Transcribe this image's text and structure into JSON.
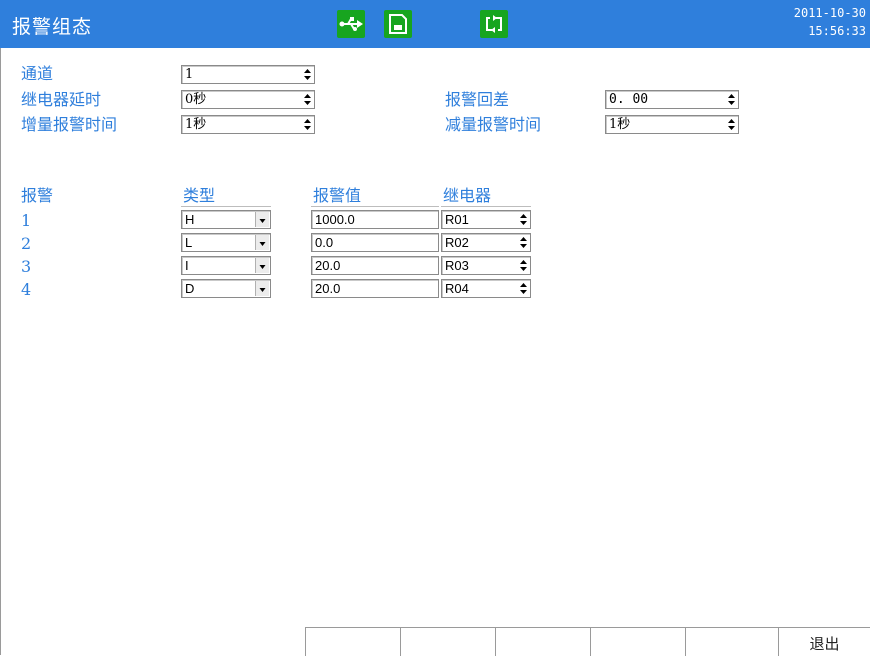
{
  "header": {
    "title": "报警组态",
    "date": "2011-10-30",
    "time": "15:56:33",
    "icons": [
      "usb-icon",
      "save-icon",
      "sync-icon"
    ],
    "accent_color": "#2f7fdc",
    "icon_color": "#17a51f"
  },
  "settings": {
    "channel_label": "通道",
    "channel_value": "1",
    "relay_delay_label": "继电器延时",
    "relay_delay_value": "0秒",
    "hysteresis_label": "报警回差",
    "hysteresis_value": "0. 00",
    "increase_time_label": "增量报警时间",
    "increase_time_value": "1秒",
    "decrease_time_label": "减量报警时间",
    "decrease_time_value": "1秒"
  },
  "alarm_table": {
    "headers": {
      "alarm": "报警",
      "type": "类型",
      "value": "报警值",
      "relay": "继电器"
    },
    "rows": [
      {
        "index": "1",
        "type": "H",
        "value": "1000.0",
        "relay": "R01"
      },
      {
        "index": "2",
        "type": "L",
        "value": "0.0",
        "relay": "R02"
      },
      {
        "index": "3",
        "type": "I",
        "value": "20.0",
        "relay": "R03"
      },
      {
        "index": "4",
        "type": "D",
        "value": "20.0",
        "relay": "R04"
      }
    ]
  },
  "footer": {
    "buttons": [
      "",
      "",
      "",
      "",
      "",
      "退出"
    ]
  }
}
